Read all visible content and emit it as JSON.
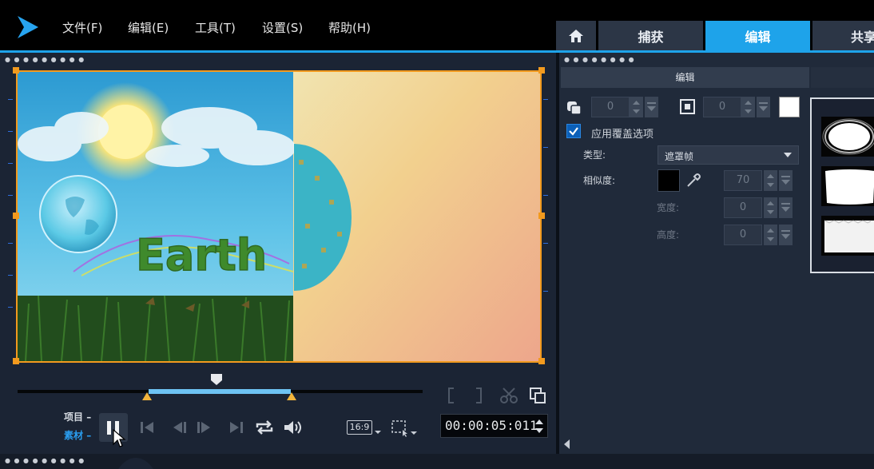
{
  "menu": {
    "file": "文件(F)",
    "edit": "编辑(E)",
    "tools": "工具(T)",
    "settings": "设置(S)",
    "help": "帮助(H)"
  },
  "tabs": {
    "home_icon": "home-icon",
    "capture": "捕获",
    "edit": "编辑",
    "share": "共享"
  },
  "preview": {
    "title_text": "Earth"
  },
  "playback": {
    "project_label": "项目",
    "clip_label": "素材",
    "aspect": "16:9",
    "timecode": "00:00:05:011"
  },
  "options": {
    "header": "编辑",
    "border_value": "0",
    "shadow_value": "0",
    "apply_overlay_label": "应用覆盖选项",
    "apply_overlay_checked": true,
    "type_label": "类型:",
    "type_value": "遮罩帧",
    "similarity_label": "相似度:",
    "similarity_value": "70",
    "width_label": "宽度:",
    "width_value": "0",
    "height_label": "高度:",
    "height_value": "0"
  },
  "colors": {
    "accent": "#1ea3ea",
    "preview_border": "#f29a1e",
    "trim_markers": "#f2b53c",
    "range": "#6ec3f3"
  }
}
